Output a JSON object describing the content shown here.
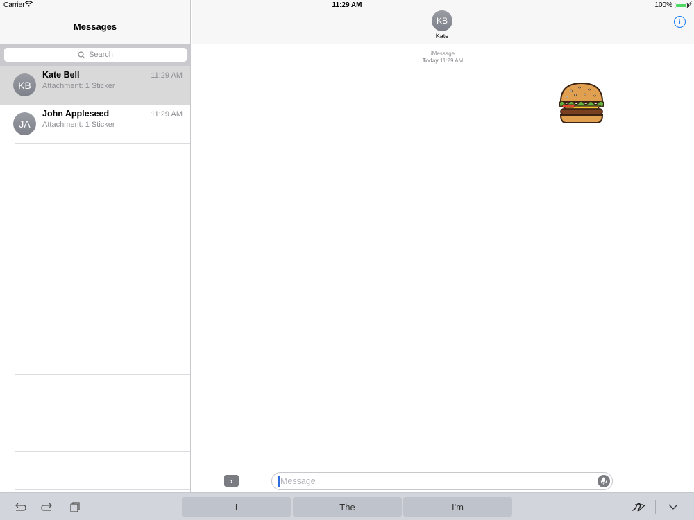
{
  "status_bar": {
    "carrier": "Carrier",
    "time": "11:29 AM",
    "battery": "100%"
  },
  "sidebar": {
    "title": "Messages",
    "search_placeholder": "Search",
    "conversations": [
      {
        "initials": "KB",
        "name": "Kate Bell",
        "preview": "Attachment: 1 Sticker",
        "time": "11:29 AM",
        "selected": true
      },
      {
        "initials": "JA",
        "name": "John Appleseed",
        "preview": "Attachment: 1 Sticker",
        "time": "11:29 AM",
        "selected": false
      }
    ]
  },
  "conversation": {
    "contact_initials": "KB",
    "contact_name": "Kate",
    "service": "iMessage",
    "date_bold": "Today",
    "date_time": "11:29 AM",
    "sticker": "hamburger-sticker"
  },
  "composer": {
    "placeholder": "Message"
  },
  "keyboard": {
    "suggestions": [
      "I",
      "The",
      "I'm"
    ]
  },
  "colors": {
    "accent": "#1a7ef7",
    "battery": "#4cd964",
    "selected_row": "#d9d9d9"
  }
}
